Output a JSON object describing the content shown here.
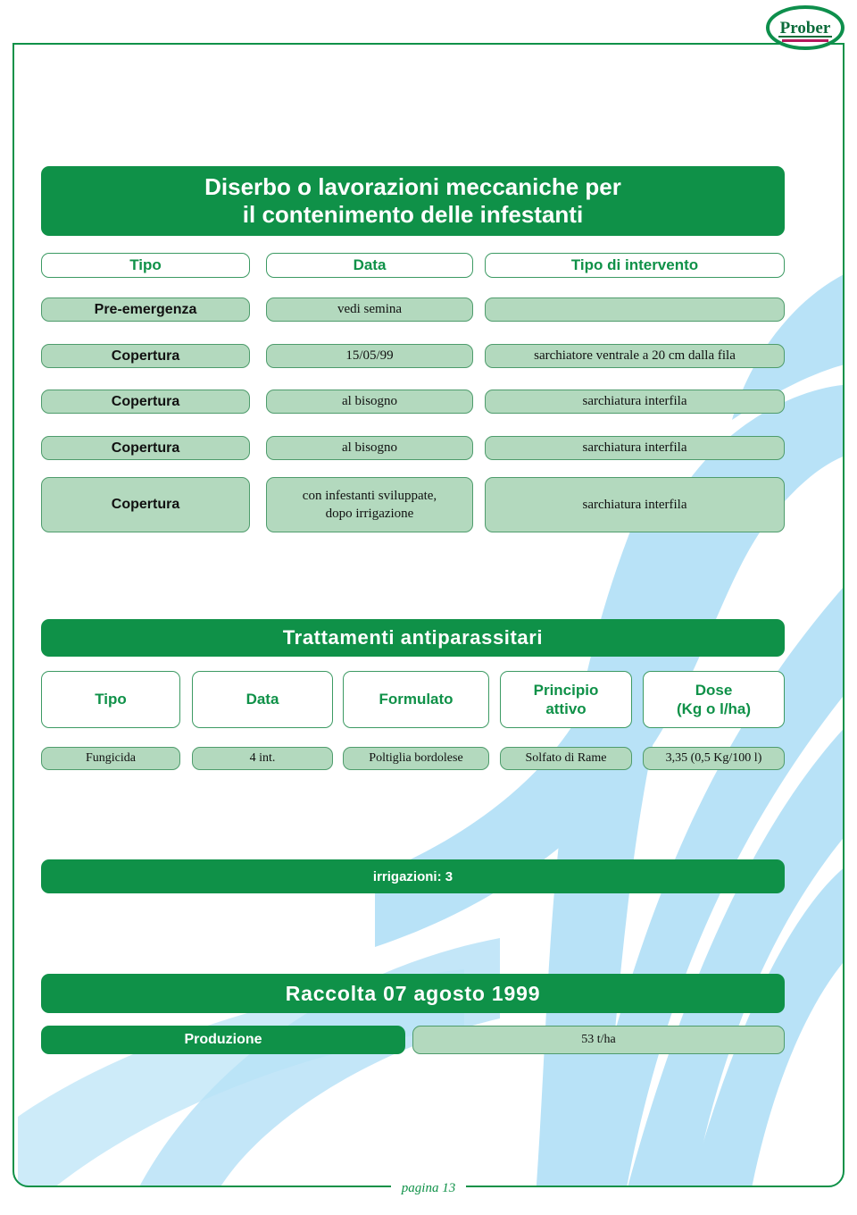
{
  "logo": {
    "brand": "Prober"
  },
  "section_disinfestation": {
    "title": "Diserbo o lavorazioni meccaniche per il contenimento delle infestanti",
    "title_line1": "Diserbo o lavorazioni meccaniche per",
    "title_line2": "il contenimento delle infestanti",
    "columns": [
      "Tipo",
      "Data",
      "Tipo di intervento"
    ],
    "rows": [
      {
        "tipo": "Pre-emergenza",
        "data": "vedi semina",
        "intervento": ""
      },
      {
        "tipo": "Copertura",
        "data": "15/05/99",
        "intervento": "sarchiatore ventrale a 20 cm dalla fila"
      },
      {
        "tipo": "Copertura",
        "data": "al bisogno",
        "intervento": "sarchiatura interfila"
      },
      {
        "tipo": "Copertura",
        "data": "al bisogno",
        "intervento": "sarchiatura interfila"
      },
      {
        "tipo": "Copertura",
        "data": "con infestanti sviluppate, dopo irrigazione",
        "data_line1": "con infestanti sviluppate,",
        "data_line2": "dopo irrigazione",
        "intervento": "sarchiatura interfila"
      }
    ]
  },
  "section_treatments": {
    "title": "Trattamenti antiparassitari",
    "columns": [
      "Tipo",
      "Data",
      "Formulato",
      "Principio attivo",
      "Dose (Kg o l/ha)"
    ],
    "columns_multiline": [
      {
        "line1": "Tipo",
        "line2": ""
      },
      {
        "line1": "Data",
        "line2": ""
      },
      {
        "line1": "Formulato",
        "line2": ""
      },
      {
        "line1": "Principio",
        "line2": "attivo"
      },
      {
        "line1": "Dose",
        "line2": "(Kg o l/ha)"
      }
    ],
    "rows": [
      {
        "tipo": "Fungicida",
        "data": "4 int.",
        "formulato": "Poltiglia bordolese",
        "principio_attivo": "Solfato di Rame",
        "dose": "3,35 (0,5 Kg/100 l)"
      }
    ]
  },
  "irrigation": {
    "label": "irrigazioni: 3"
  },
  "harvest": {
    "title": "Raccolta 07 agosto 1999",
    "production_label": "Produzione",
    "production_value": "53 t/ha"
  },
  "footer": {
    "page": "pagina 13"
  },
  "colors": {
    "green": "#0f9148",
    "light_green": "#b3d9be",
    "border_green": "#4e9c6c",
    "watermark_blue": "#b8e2f7",
    "logo_accent": "#b5185c"
  }
}
